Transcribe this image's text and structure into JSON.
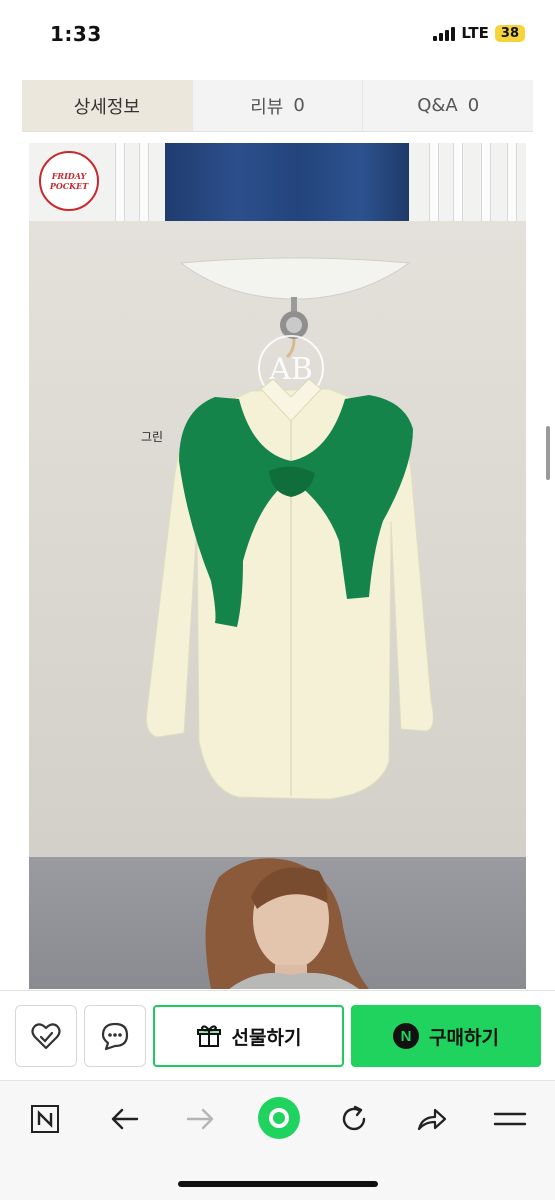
{
  "status_bar": {
    "time": "1:33",
    "network": "LTE",
    "battery": "38"
  },
  "tabs": [
    {
      "label": "상세정보",
      "count": "",
      "active": true
    },
    {
      "label": "리뷰",
      "count": "0",
      "active": false
    },
    {
      "label": "Q&A",
      "count": "0",
      "active": false
    }
  ],
  "content": {
    "badge_text": [
      "FRIDAY",
      "POCKET"
    ],
    "color_label": "그린",
    "brand_mark": "AB"
  },
  "purchase_bar": {
    "gift_label": "선물하기",
    "order_label": "구매하기",
    "order_badge": "N",
    "accent_color": "#1fd35e"
  },
  "browser_toolbar": {
    "home_badge": "N",
    "icons": [
      "naver-home-icon",
      "back-arrow-icon",
      "forward-arrow-icon",
      "green-dot-icon",
      "refresh-icon",
      "share-icon",
      "menu-icon"
    ]
  }
}
